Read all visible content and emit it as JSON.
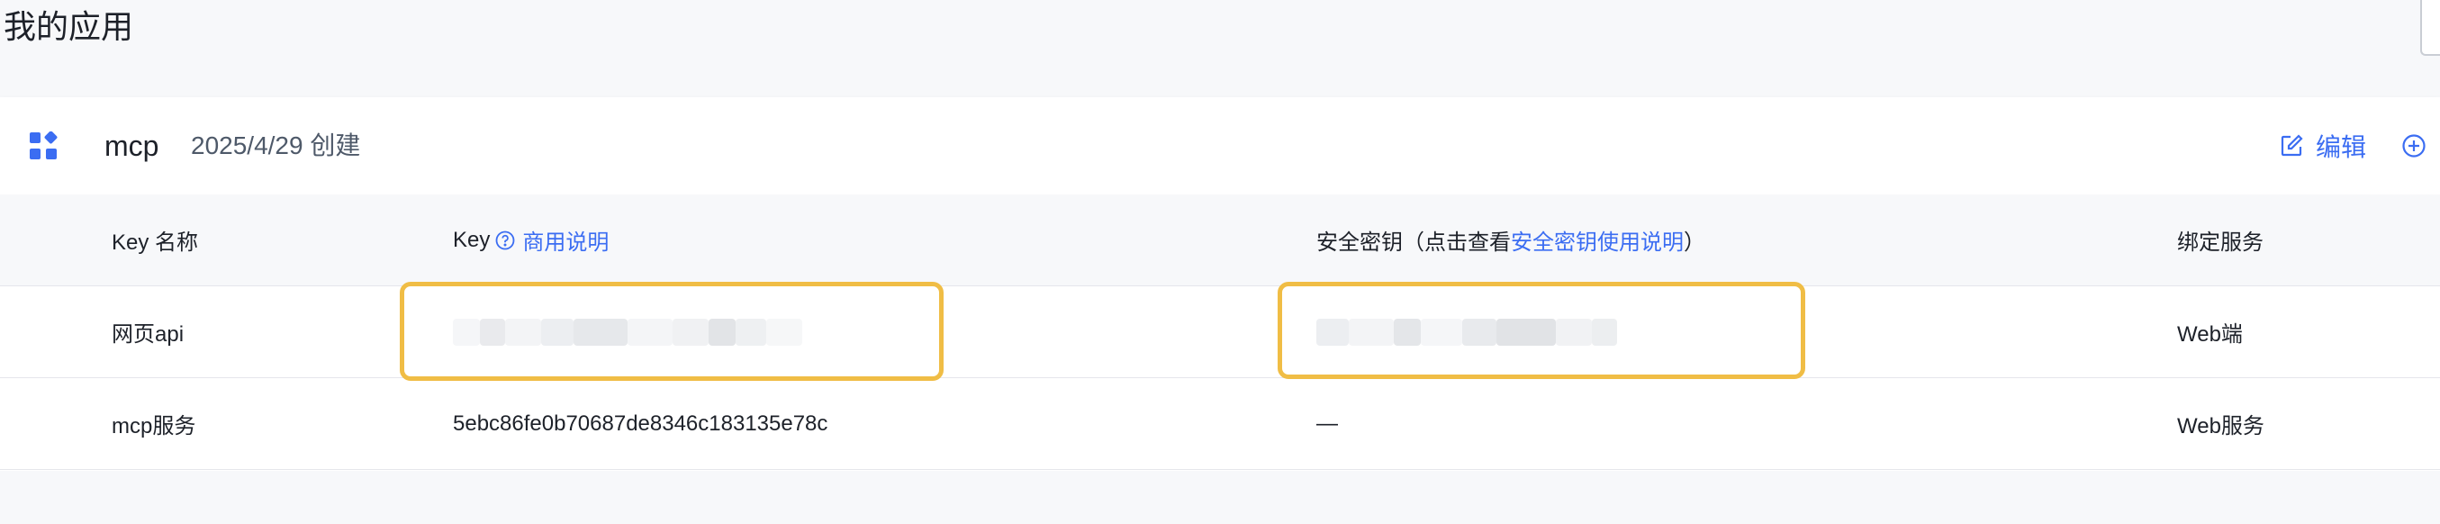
{
  "page": {
    "title": "我的应用"
  },
  "app": {
    "name": "mcp",
    "created": "2025/4/29 创建",
    "edit_label": "编辑",
    "icon": "app-grid-icon",
    "accent": "#3b6df2"
  },
  "table": {
    "headers": {
      "key_name": "Key 名称",
      "key": "Key",
      "key_link": "商用说明",
      "secret_prefix": "安全密钥（点击查看",
      "secret_link": "安全密钥使用说明",
      "secret_suffix": "）",
      "service": "绑定服务"
    },
    "rows": [
      {
        "name": "网页api",
        "key": "",
        "secret": "",
        "service": "Web端"
      },
      {
        "name": "mcp服务",
        "key": "5ebc86fe0b70687de8346c183135e78c",
        "secret": "—",
        "service": "Web服务"
      }
    ]
  },
  "highlight_color": "#f0bd45"
}
